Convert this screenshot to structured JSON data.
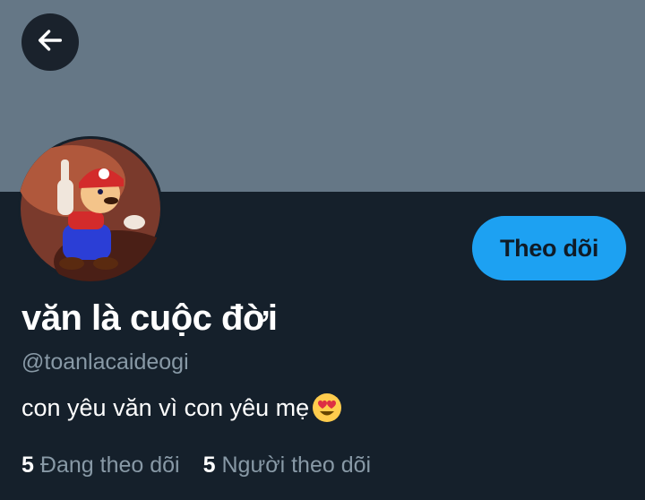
{
  "header": {
    "back_icon": "arrow-left-icon"
  },
  "profile": {
    "display_name": "văn là cuộc đời",
    "handle": "@toanlacaideogi",
    "bio_text": "con yêu văn vì con yêu mẹ",
    "bio_emoji": "heart-eyes-emoji",
    "follow_label": "Theo dõi",
    "following_count": "5",
    "following_label": "Đang theo dõi",
    "followers_count": "5",
    "followers_label": "Người theo dõi"
  },
  "colors": {
    "background": "#15202b",
    "banner": "#657786",
    "accent": "#1da1f2",
    "secondary_text": "#8899a6"
  }
}
